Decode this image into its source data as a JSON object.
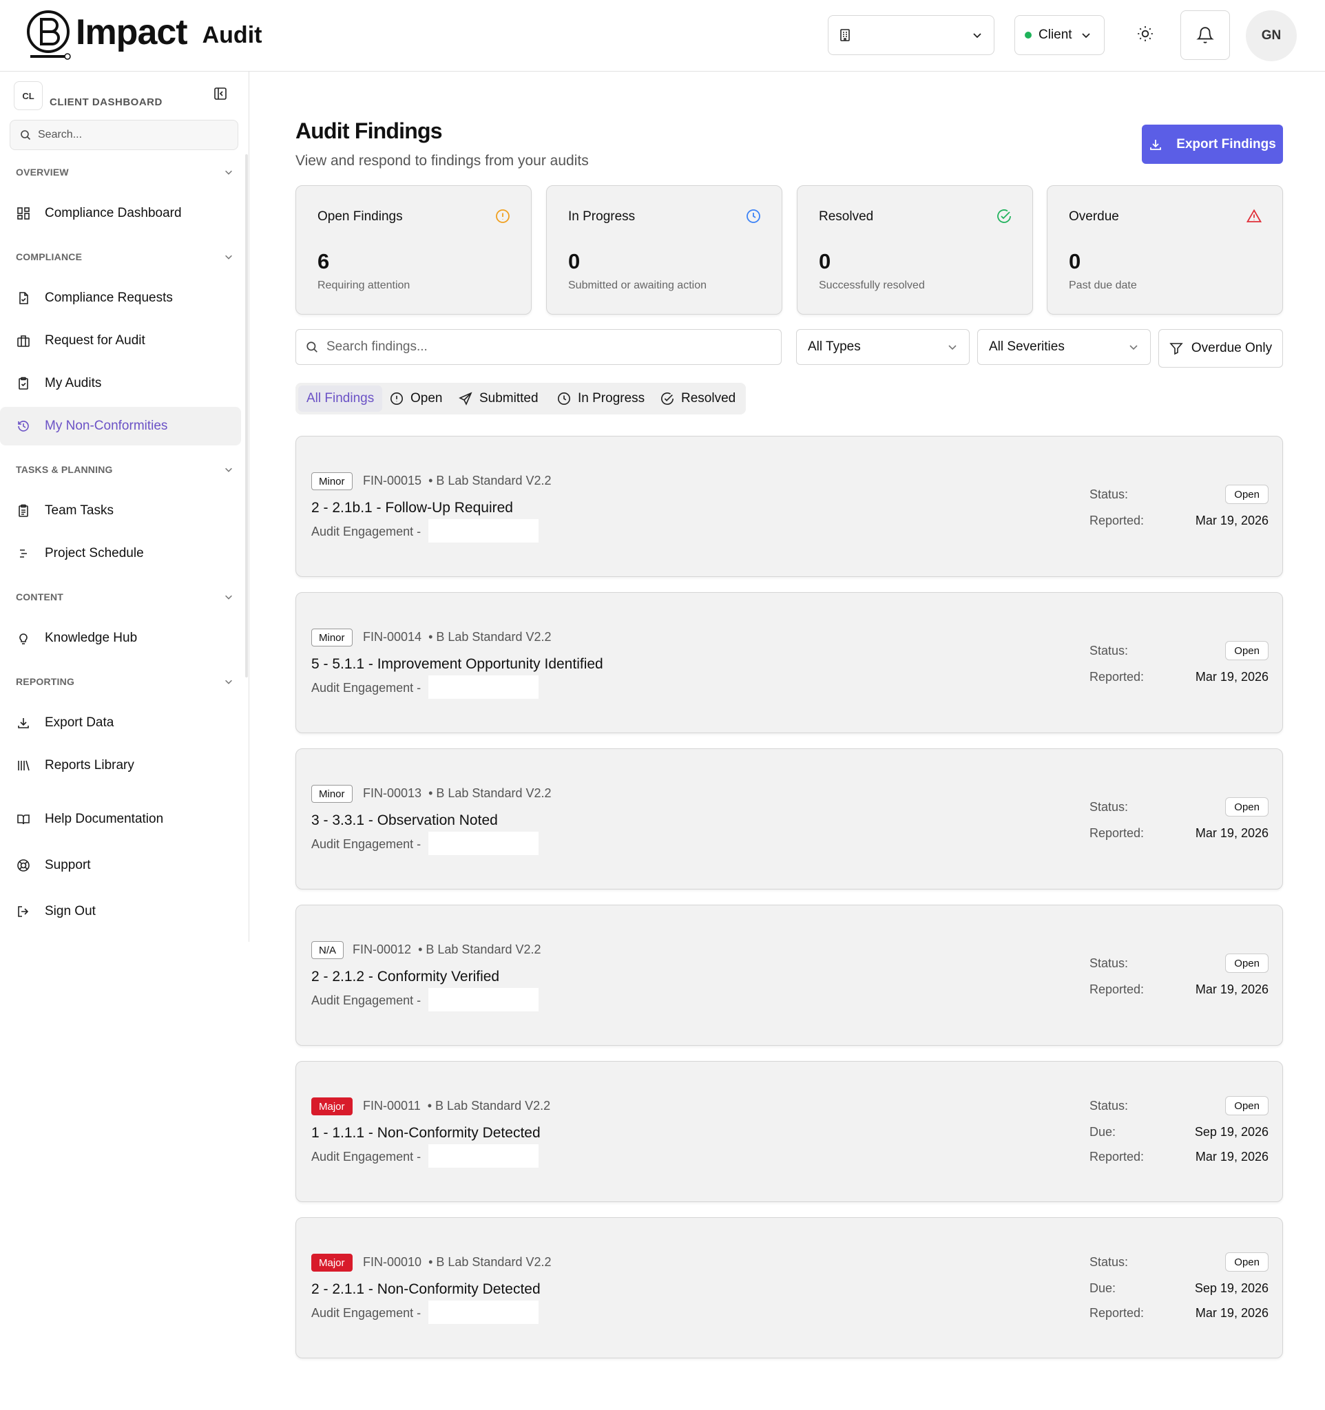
{
  "header": {
    "logo_word": "Impact",
    "logo_product": "Audit",
    "role": "Client",
    "avatar_initials": "GN",
    "role_dot_color": "#1fb35a"
  },
  "sidebar": {
    "badge": "CL",
    "title": "CLIENT DASHBOARD",
    "search_placeholder": "Search...",
    "sections": {
      "overview": "OVERVIEW",
      "compliance": "COMPLIANCE",
      "tasks": "TASKS & PLANNING",
      "content": "CONTENT",
      "reporting": "REPORTING"
    },
    "items": {
      "compliance_dashboard": "Compliance Dashboard",
      "compliance_requests": "Compliance Requests",
      "request_for_audit": "Request for Audit",
      "my_audits": "My Audits",
      "my_non_conformities": "My Non-Conformities",
      "team_tasks": "Team Tasks",
      "project_schedule": "Project Schedule",
      "knowledge_hub": "Knowledge Hub",
      "export_data": "Export Data",
      "reports_library": "Reports Library",
      "help_documentation": "Help Documentation",
      "support": "Support",
      "sign_out": "Sign Out"
    },
    "active_color": "#6b52c6"
  },
  "main": {
    "title": "Audit Findings",
    "subtitle": "View and respond to findings from your audits",
    "export_label": "Export Findings",
    "accent": "#5b5ee6",
    "stats": [
      {
        "label": "Open Findings",
        "value": "6",
        "desc": "Requiring attention",
        "icon": "alert-circle-icon",
        "color": "#f0a020"
      },
      {
        "label": "In Progress",
        "value": "0",
        "desc": "Submitted or awaiting action",
        "icon": "clock-icon",
        "color": "#3b82f6"
      },
      {
        "label": "Resolved",
        "value": "0",
        "desc": "Successfully resolved",
        "icon": "check-circle-icon",
        "color": "#22b35e"
      },
      {
        "label": "Overdue",
        "value": "0",
        "desc": "Past due date",
        "icon": "warning-triangle-icon",
        "color": "#e0303a"
      }
    ],
    "search_placeholder": "Search findings...",
    "type_filter": "All Types",
    "severity_filter": "All Severities",
    "overdue_label": "Overdue Only",
    "tabs": [
      "All Findings",
      "Open",
      "Submitted",
      "In Progress",
      "Resolved"
    ],
    "labels": {
      "status": "Status:",
      "due": "Due:",
      "reported": "Reported:",
      "engagement": "Audit Engagement -"
    },
    "findings": [
      {
        "severity": "Minor",
        "id": "FIN-00015",
        "standard": "• B Lab Standard V2.2",
        "title": "2 - 2.1b.1 - Follow-Up Required",
        "status": "Open",
        "due": "",
        "reported": "Mar 19, 2026"
      },
      {
        "severity": "Minor",
        "id": "FIN-00014",
        "standard": "• B Lab Standard V2.2",
        "title": "5 - 5.1.1 - Improvement Opportunity Identified",
        "status": "Open",
        "due": "",
        "reported": "Mar 19, 2026"
      },
      {
        "severity": "Minor",
        "id": "FIN-00013",
        "standard": "• B Lab Standard V2.2",
        "title": "3 - 3.3.1 - Observation Noted",
        "status": "Open",
        "due": "",
        "reported": "Mar 19, 2026"
      },
      {
        "severity": "N/A",
        "id": "FIN-00012",
        "standard": "• B Lab Standard V2.2",
        "title": "2 - 2.1.2 - Conformity Verified",
        "status": "Open",
        "due": "",
        "reported": "Mar 19, 2026"
      },
      {
        "severity": "Major",
        "id": "FIN-00011",
        "standard": "• B Lab Standard V2.2",
        "title": "1 - 1.1.1 - Non-Conformity Detected",
        "status": "Open",
        "due": "Sep 19, 2026",
        "reported": "Mar 19, 2026"
      },
      {
        "severity": "Major",
        "id": "FIN-00010",
        "standard": "• B Lab Standard V2.2",
        "title": "2 - 2.1.1 - Non-Conformity Detected",
        "status": "Open",
        "due": "Sep 19, 2026",
        "reported": "Mar 19, 2026"
      }
    ]
  }
}
